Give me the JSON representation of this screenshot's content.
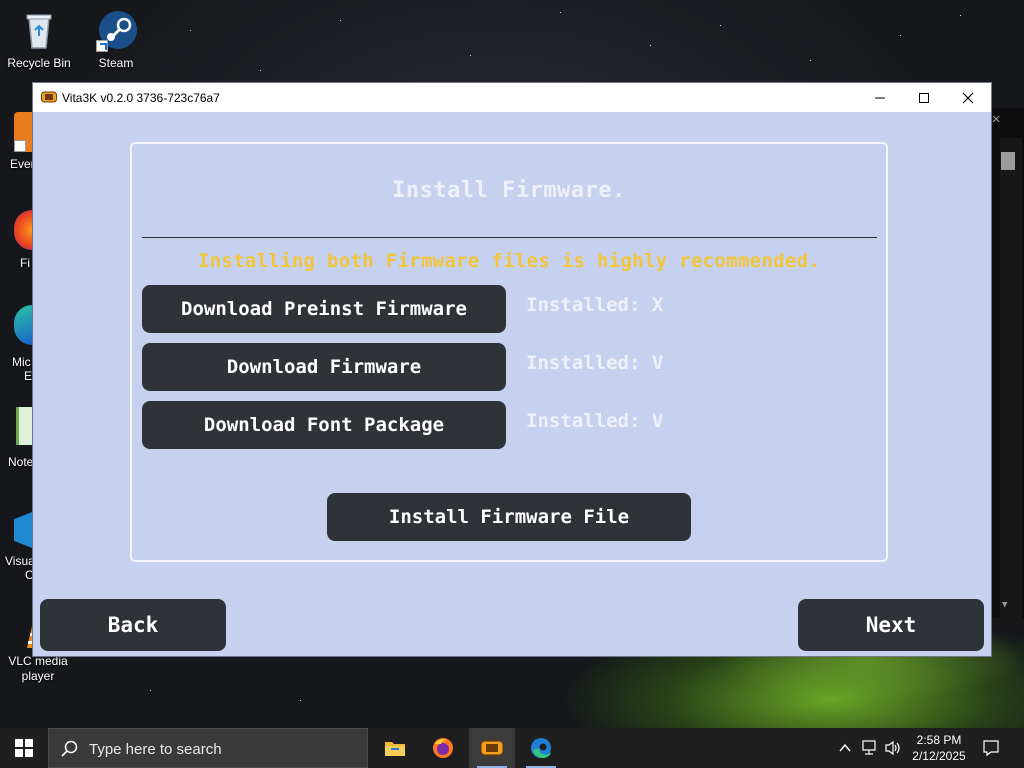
{
  "desktop": {
    "icons": [
      {
        "label": "Recycle Bin"
      },
      {
        "label": "Steam"
      },
      {
        "label": "VLC media player"
      }
    ],
    "partial_icons": [
      {
        "label": "Ever"
      },
      {
        "label": "Fi"
      },
      {
        "label": "Mic"
      },
      {
        "label": "E"
      },
      {
        "label": "Note"
      },
      {
        "label": "Visua"
      },
      {
        "label": "C"
      }
    ]
  },
  "window": {
    "title": "Vita3K v0.2.0 3736-723c76a7",
    "controls": {
      "minimize": "minimize",
      "maximize": "maximize",
      "close": "close"
    }
  },
  "setup": {
    "heading": "Install Firmware.",
    "recommendation": "Installing both Firmware files is highly recommended.",
    "rows": [
      {
        "button": "Download Preinst Firmware",
        "status": "Installed: X"
      },
      {
        "button": "Download Firmware",
        "status": "Installed: V"
      },
      {
        "button": "Download Font Package",
        "status": "Installed: V"
      }
    ],
    "install_file_button": "Install Firmware File",
    "back_button": "Back",
    "next_button": "Next"
  },
  "taskbar": {
    "search_placeholder": "Type here to search",
    "apps": [
      "File Explorer",
      "Firefox",
      "Vita3K",
      "Microsoft Edge"
    ],
    "time": "2:58 PM",
    "date": "2/12/2025"
  },
  "colors": {
    "window_bg": "#c5d1ef",
    "button_bg": "#2f3237",
    "warning_text": "#f3c53a",
    "taskbar_bg": "#1f1f1f"
  }
}
